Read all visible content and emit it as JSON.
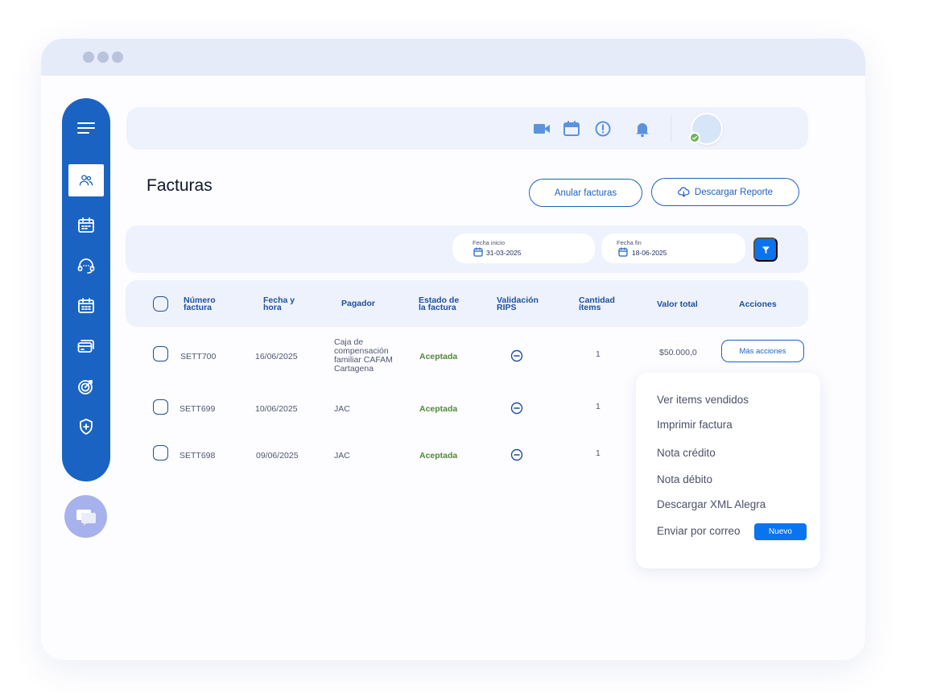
{
  "page": {
    "title": "Facturas"
  },
  "actions": {
    "cancel_invoices": "Anular facturas",
    "download_report": "Descargar Reporte"
  },
  "filters": {
    "start_label": "Fecha inicio",
    "start_value": "31-03-2025",
    "end_label": "Fecha fin",
    "end_value": "18-06-2025"
  },
  "table": {
    "headers": {
      "number": [
        "Número",
        "factura"
      ],
      "date": [
        "Fecha y",
        "hora"
      ],
      "payer": [
        "Pagador"
      ],
      "status": [
        "Estado de",
        "la factura"
      ],
      "rips": [
        "Validación",
        "RIPS"
      ],
      "qty": [
        "Cantidad",
        "ítems"
      ],
      "total": [
        "Valor total"
      ],
      "actions": [
        "Acciones"
      ]
    },
    "rows": [
      {
        "number": "SETT700",
        "date": "16/06/2025",
        "payer_lines": [
          "Caja de",
          "compensación",
          "familiar CAFAM",
          "Cartagena"
        ],
        "status": "Aceptada",
        "qty": "1",
        "total": "$50.000,0",
        "action": "Más acciones"
      },
      {
        "number": "SETT699",
        "date": "10/06/2025",
        "payer_lines": [
          "JAC"
        ],
        "status": "Aceptada",
        "qty": "1"
      },
      {
        "number": "SETT698",
        "date": "09/06/2025",
        "payer_lines": [
          "JAC"
        ],
        "status": "Aceptada",
        "qty": "1"
      }
    ]
  },
  "menu": {
    "items": [
      "Ver items vendidos",
      "Imprimir factura",
      "Nota crédito",
      "Nota débito",
      "Descargar XML Alegra",
      "Enviar por correo"
    ],
    "badge": "Nuevo"
  },
  "sidebar": {
    "icons": [
      "menu-icon",
      "users-icon",
      "calendar-icon",
      "support-headset-icon",
      "calendar-schedule-icon",
      "payment-card-icon",
      "target-icon",
      "shield-icon"
    ]
  },
  "colors": {
    "brand_blue": "#1a63c2",
    "accent_blue": "#0a74f0",
    "accepted_green": "#4f8a3a",
    "panel_bg": "#eef2fd"
  }
}
